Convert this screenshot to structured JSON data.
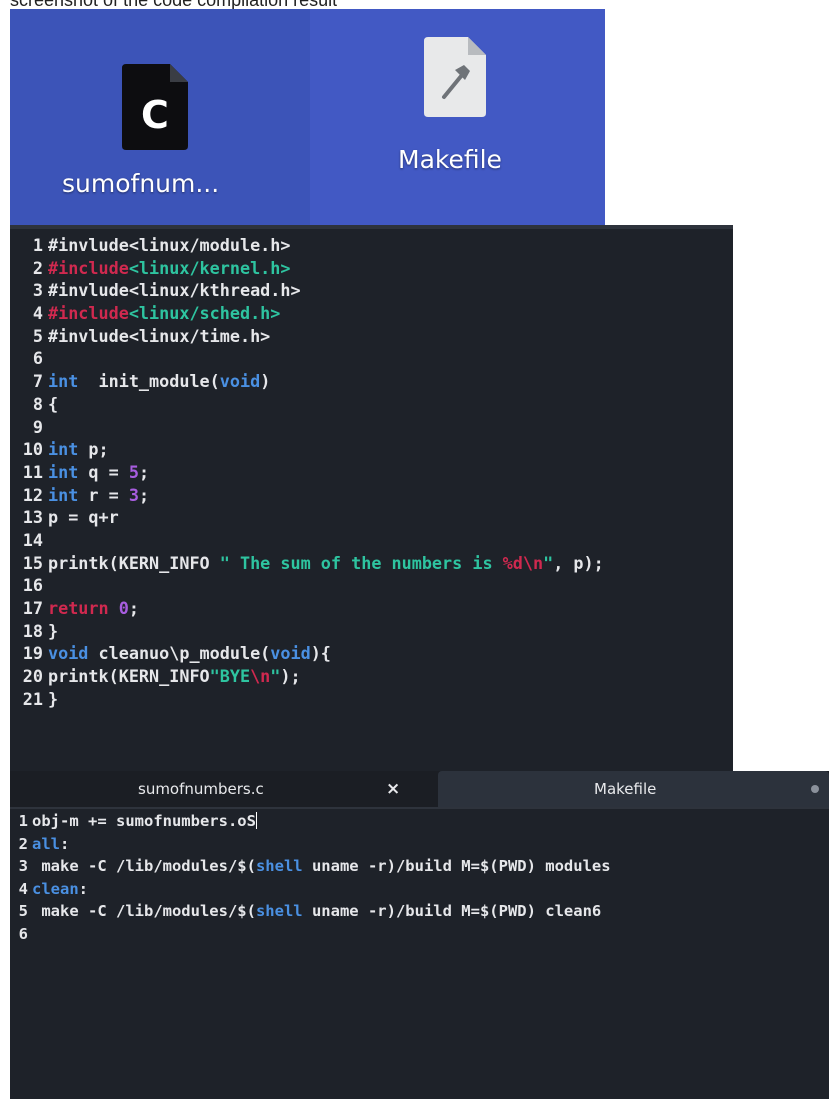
{
  "caption": "screenshot of the code compilation result",
  "desktop": {
    "files": [
      {
        "name": "sumofnum...",
        "icon": "c-source-file-icon"
      },
      {
        "name": "Makefile",
        "icon": "makefile-hammer-icon"
      }
    ],
    "colors": {
      "c_tile": "#3c54b8",
      "makefile_tile": "#4259c4"
    }
  },
  "editor_c": {
    "lines": [
      {
        "n": "1",
        "parts": [
          {
            "t": "#invlude<linux/module.h>",
            "c": ""
          }
        ]
      },
      {
        "n": "2",
        "parts": [
          {
            "t": "#include",
            "c": "red"
          },
          {
            "t": "<linux/kernel.h>",
            "c": "teal"
          }
        ]
      },
      {
        "n": "3",
        "parts": [
          {
            "t": "#invlude<linux/kthread.h>",
            "c": ""
          }
        ]
      },
      {
        "n": "4",
        "parts": [
          {
            "t": "#include",
            "c": "red"
          },
          {
            "t": "<linux/sched.h>",
            "c": "teal"
          }
        ]
      },
      {
        "n": "5",
        "parts": [
          {
            "t": "#invlude<linux/time.h>",
            "c": ""
          }
        ]
      },
      {
        "n": "6",
        "parts": []
      },
      {
        "n": "7",
        "parts": [
          {
            "t": "int",
            "c": "kw"
          },
          {
            "t": "  init_module(",
            "c": ""
          },
          {
            "t": "void",
            "c": "kw"
          },
          {
            "t": ")",
            "c": ""
          }
        ]
      },
      {
        "n": "8",
        "parts": [
          {
            "t": "{",
            "c": ""
          }
        ]
      },
      {
        "n": "9",
        "parts": []
      },
      {
        "n": "10",
        "parts": [
          {
            "t": "int",
            "c": "kw"
          },
          {
            "t": " p;",
            "c": ""
          }
        ]
      },
      {
        "n": "11",
        "parts": [
          {
            "t": "int",
            "c": "kw"
          },
          {
            "t": " q = ",
            "c": ""
          },
          {
            "t": "5",
            "c": "num"
          },
          {
            "t": ";",
            "c": ""
          }
        ]
      },
      {
        "n": "12",
        "parts": [
          {
            "t": "int",
            "c": "kw"
          },
          {
            "t": " r = ",
            "c": ""
          },
          {
            "t": "3",
            "c": "num"
          },
          {
            "t": ";",
            "c": ""
          }
        ]
      },
      {
        "n": "13",
        "parts": [
          {
            "t": "p = q+r",
            "c": ""
          }
        ]
      },
      {
        "n": "14",
        "parts": []
      },
      {
        "n": "15",
        "parts": [
          {
            "t": "printk(KERN_INFO ",
            "c": ""
          },
          {
            "t": "\" The sum of the numbers is ",
            "c": "teal"
          },
          {
            "t": "%d\\n",
            "c": "red"
          },
          {
            "t": "\"",
            "c": "teal"
          },
          {
            "t": ", p);",
            "c": ""
          }
        ]
      },
      {
        "n": "16",
        "parts": []
      },
      {
        "n": "17",
        "parts": [
          {
            "t": "return",
            "c": "red"
          },
          {
            "t": " ",
            "c": ""
          },
          {
            "t": "0",
            "c": "num"
          },
          {
            "t": ";",
            "c": ""
          }
        ]
      },
      {
        "n": "18",
        "parts": [
          {
            "t": "}",
            "c": ""
          }
        ]
      },
      {
        "n": "19",
        "parts": [
          {
            "t": "void",
            "c": "kw"
          },
          {
            "t": " cleanuo\\p_module(",
            "c": ""
          },
          {
            "t": "void",
            "c": "kw"
          },
          {
            "t": "){",
            "c": ""
          }
        ]
      },
      {
        "n": "20",
        "parts": [
          {
            "t": "printk(KERN_INFO",
            "c": ""
          },
          {
            "t": "\"BYE",
            "c": "teal"
          },
          {
            "t": "\\n",
            "c": "red"
          },
          {
            "t": "\"",
            "c": "teal"
          },
          {
            "t": ");",
            "c": ""
          }
        ]
      },
      {
        "n": "21",
        "parts": [
          {
            "t": "}",
            "c": ""
          }
        ]
      }
    ]
  },
  "tabs": [
    {
      "label": "sumofnumbers.c",
      "close": "×",
      "active": true
    },
    {
      "label": "Makefile",
      "active": false,
      "modified": true
    }
  ],
  "editor_make": {
    "lines": [
      {
        "n": "1",
        "parts": [
          {
            "t": "obj-m += sumofnumbers.oS",
            "c": ""
          }
        ],
        "cursor": true
      },
      {
        "n": "2",
        "parts": [
          {
            "t": "all",
            "c": "kw"
          },
          {
            "t": ":",
            "c": ""
          }
        ]
      },
      {
        "n": "3",
        "parts": [
          {
            "t": " make -C /lib/modules/$(",
            "c": ""
          },
          {
            "t": "shell",
            "c": "kw"
          },
          {
            "t": " uname -r)/build M=$(PWD) modules",
            "c": ""
          }
        ]
      },
      {
        "n": "4",
        "parts": [
          {
            "t": "clean",
            "c": "kw"
          },
          {
            "t": ":",
            "c": ""
          }
        ]
      },
      {
        "n": "5",
        "parts": [
          {
            "t": " make -C /lib/modules/$(",
            "c": ""
          },
          {
            "t": "shell",
            "c": "kw"
          },
          {
            "t": " uname -r)/build M=$(PWD) clean6",
            "c": ""
          }
        ]
      },
      {
        "n": "6",
        "parts": []
      }
    ]
  }
}
